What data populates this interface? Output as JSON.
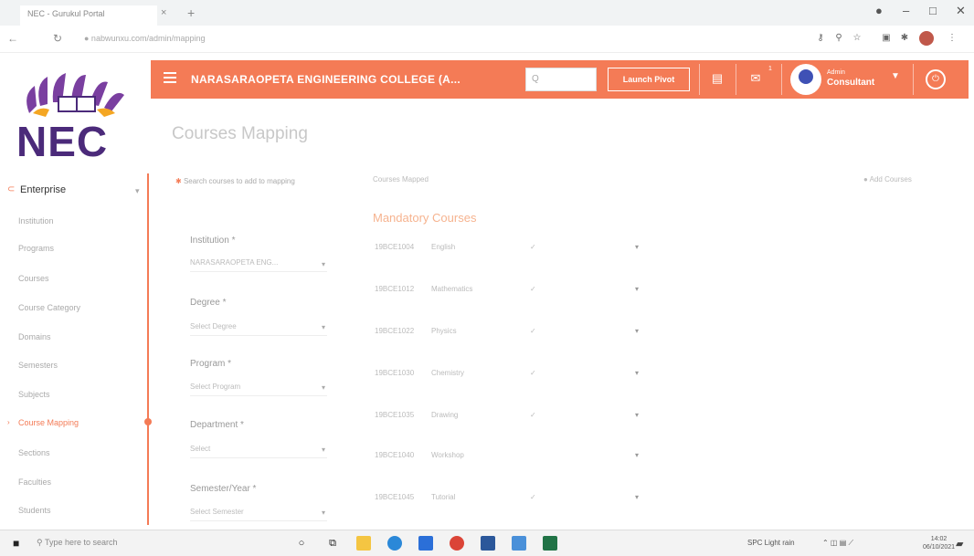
{
  "browser": {
    "tab_title": "NEC - Gurukul Portal",
    "new_tab": "+",
    "url": "● nabwunxu.com/admin/mapping",
    "window_controls": [
      "–",
      "□",
      "✕"
    ]
  },
  "header": {
    "college_name": "NARASARAOPETA ENGINEERING COLLEGE (A...",
    "search_placeholder": "Q",
    "launch_button": "Launch Pivot",
    "notification_count": "1",
    "user_role": "Admin",
    "user_name": "Consultant"
  },
  "logo": {
    "text": "NEC"
  },
  "sidebar": {
    "heading": "Enterprise",
    "items": [
      "Institution",
      "Programs",
      "Courses",
      "Course Category",
      "Domains",
      "Semesters",
      "Subjects",
      "Course Mapping",
      "Sections",
      "Faculties",
      "Students"
    ],
    "active_index": 7
  },
  "page": {
    "title": "Courses Mapping",
    "form_hint": "Search courses to add to mapping",
    "form_hint_marker": "✱",
    "fields": [
      {
        "label": "Institution *",
        "value": "NARASARAOPETA ENG..."
      },
      {
        "label": "Degree *",
        "value": "Select Degree"
      },
      {
        "label": "Program *",
        "value": "Select Program"
      },
      {
        "label": "Department *",
        "value": "Select"
      },
      {
        "label": "Semester/Year *",
        "value": "Select Semester"
      }
    ]
  },
  "courses_panel": {
    "header": "Courses Mapped",
    "action": "● Add Courses",
    "section_title": "Mandatory Courses",
    "rows": [
      {
        "code": "19BCE1004",
        "name": "English",
        "tick": "✓",
        "dd": "▾"
      },
      {
        "code": "19BCE1012",
        "name": "Mathematics",
        "tick": "✓",
        "dd": "▾"
      },
      {
        "code": "19BCE1022",
        "name": "Physics",
        "tick": "✓",
        "dd": "▾"
      },
      {
        "code": "19BCE1030",
        "name": "Chemistry",
        "tick": "✓",
        "dd": "▾"
      },
      {
        "code": "19BCE1035",
        "name": "Drawing",
        "tick": "✓",
        "dd": "▾"
      },
      {
        "code": "19BCE1040",
        "name": "Workshop",
        "tick": "",
        "dd": "▾"
      },
      {
        "code": "19BCE1045",
        "name": "Tutorial",
        "tick": "✓",
        "dd": "▾"
      }
    ]
  },
  "taskbar": {
    "search_placeholder": "Type here to search",
    "tray_text": "SPC Light rain",
    "clock_time": "14:02",
    "clock_date": "06/10/2021"
  },
  "colors": {
    "accent": "#f47b56",
    "logo_purple": "#4b2a7a"
  }
}
